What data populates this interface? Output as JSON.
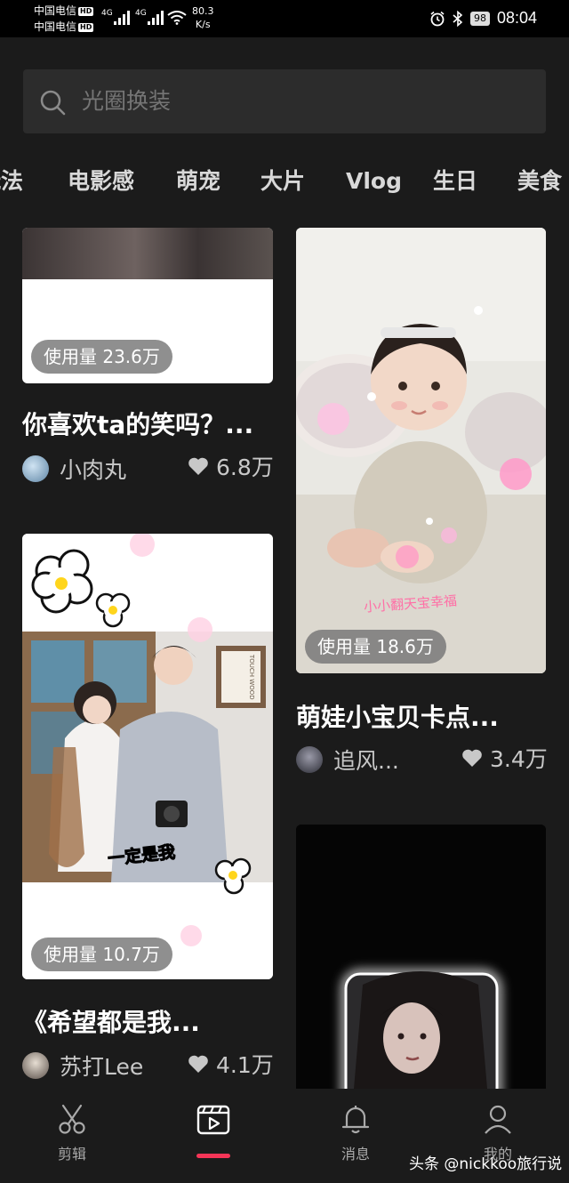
{
  "status_bar": {
    "carrier_1": "中国电信",
    "carrier_2": "中国电信",
    "hd": "HD",
    "net_1": "4G",
    "net_2": "4G",
    "speed_value": "80.3",
    "speed_unit": "K/s",
    "battery": "98",
    "time": "08:04",
    "icons": [
      "alarm-icon",
      "bluetooth-icon",
      "wifi-icon",
      "signal-icon",
      "battery-icon"
    ]
  },
  "search": {
    "placeholder": "光圈换装",
    "icon": "search-icon"
  },
  "tabs": [
    "玩法",
    "电影感",
    "萌宠",
    "大片",
    "Vlog",
    "生日",
    "美食"
  ],
  "cards": [
    {
      "usage": "使用量 23.6万",
      "title": "你喜欢ta的笑吗？...",
      "author": "小肉丸",
      "likes": "6.8万"
    },
    {
      "usage": "使用量 18.6万",
      "title": "萌娃小宝贝卡点...",
      "author": "追风...",
      "likes": "3.4万",
      "overlay_text": "小小翻天宝幸福"
    },
    {
      "usage": "使用量 10.7万",
      "title": "《希望都是我...",
      "author": "苏打Lee",
      "likes": "4.1万",
      "overlay_text": "一定是我",
      "frame_text": "TOUCH WOOD"
    },
    {
      "usage": "",
      "title": "",
      "author": "",
      "likes": ""
    }
  ],
  "bottom_nav": [
    {
      "label": "剪辑",
      "icon": "scissors-icon"
    },
    {
      "label": "",
      "icon": "template-play-icon",
      "active": true
    },
    {
      "label": "消息",
      "icon": "bell-icon"
    },
    {
      "label": "我的",
      "icon": "person-icon"
    }
  ],
  "watermark": "头条 @nickkoo旅行说",
  "colors": {
    "background": "#1b1b1b",
    "search_bg": "#2c2c2c",
    "active_indicator": "#f53557"
  }
}
